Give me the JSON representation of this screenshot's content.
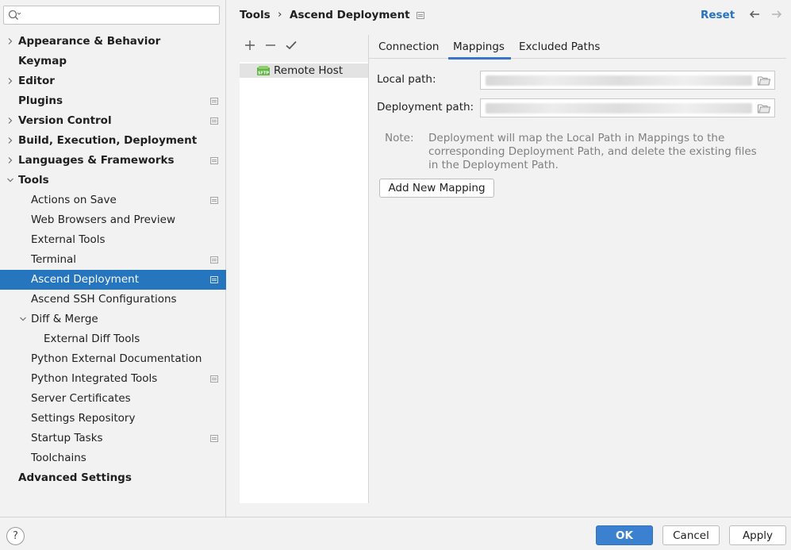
{
  "search": {
    "placeholder": ""
  },
  "sidebar": {
    "items": [
      {
        "label": "Appearance & Behavior",
        "level": 0,
        "bold": true,
        "expander": "collapsed",
        "badge": false,
        "selected": false
      },
      {
        "label": "Keymap",
        "level": 0,
        "bold": true,
        "expander": "none",
        "badge": false,
        "selected": false
      },
      {
        "label": "Editor",
        "level": 0,
        "bold": true,
        "expander": "collapsed",
        "badge": false,
        "selected": false
      },
      {
        "label": "Plugins",
        "level": 0,
        "bold": true,
        "expander": "none",
        "badge": true,
        "selected": false
      },
      {
        "label": "Version Control",
        "level": 0,
        "bold": true,
        "expander": "collapsed",
        "badge": true,
        "selected": false
      },
      {
        "label": "Build, Execution, Deployment",
        "level": 0,
        "bold": true,
        "expander": "collapsed",
        "badge": false,
        "selected": false
      },
      {
        "label": "Languages & Frameworks",
        "level": 0,
        "bold": true,
        "expander": "collapsed",
        "badge": true,
        "selected": false
      },
      {
        "label": "Tools",
        "level": 0,
        "bold": true,
        "expander": "expanded",
        "badge": false,
        "selected": false
      },
      {
        "label": "Actions on Save",
        "level": 1,
        "bold": false,
        "expander": "none",
        "badge": true,
        "selected": false
      },
      {
        "label": "Web Browsers and Preview",
        "level": 1,
        "bold": false,
        "expander": "none",
        "badge": false,
        "selected": false
      },
      {
        "label": "External Tools",
        "level": 1,
        "bold": false,
        "expander": "none",
        "badge": false,
        "selected": false
      },
      {
        "label": "Terminal",
        "level": 1,
        "bold": false,
        "expander": "none",
        "badge": true,
        "selected": false
      },
      {
        "label": "Ascend Deployment",
        "level": 1,
        "bold": false,
        "expander": "none",
        "badge": true,
        "selected": true
      },
      {
        "label": "Ascend SSH Configurations",
        "level": 1,
        "bold": false,
        "expander": "none",
        "badge": false,
        "selected": false
      },
      {
        "label": "Diff & Merge",
        "level": 1,
        "bold": false,
        "expander": "expanded",
        "badge": false,
        "selected": false
      },
      {
        "label": "External Diff Tools",
        "level": 2,
        "bold": false,
        "expander": "none",
        "badge": false,
        "selected": false
      },
      {
        "label": "Python External Documentation",
        "level": 1,
        "bold": false,
        "expander": "none",
        "badge": false,
        "selected": false
      },
      {
        "label": "Python Integrated Tools",
        "level": 1,
        "bold": false,
        "expander": "none",
        "badge": true,
        "selected": false
      },
      {
        "label": "Server Certificates",
        "level": 1,
        "bold": false,
        "expander": "none",
        "badge": false,
        "selected": false
      },
      {
        "label": "Settings Repository",
        "level": 1,
        "bold": false,
        "expander": "none",
        "badge": false,
        "selected": false
      },
      {
        "label": "Startup Tasks",
        "level": 1,
        "bold": false,
        "expander": "none",
        "badge": true,
        "selected": false
      },
      {
        "label": "Toolchains",
        "level": 1,
        "bold": false,
        "expander": "none",
        "badge": false,
        "selected": false
      },
      {
        "label": "Advanced Settings",
        "level": 0,
        "bold": true,
        "expander": "none",
        "badge": false,
        "selected": false
      }
    ]
  },
  "header": {
    "breadcrumb_parent": "Tools",
    "breadcrumb_separator": "›",
    "breadcrumb_current": "Ascend Deployment",
    "reset_label": "Reset"
  },
  "servers": {
    "toolbar": {
      "add_icon": "plus-icon",
      "remove_icon": "minus-icon",
      "default_icon": "check-icon"
    },
    "items": [
      {
        "label": "Remote Host",
        "icon": "sftp-icon",
        "selected": true
      }
    ]
  },
  "tabs": [
    {
      "label": "Connection",
      "active": false
    },
    {
      "label": "Mappings",
      "active": true
    },
    {
      "label": "Excluded Paths",
      "active": false
    }
  ],
  "mapping": {
    "local_label": "Local path:",
    "local_value": "",
    "deployment_label": "Deployment path:",
    "deployment_value": "",
    "note_label": "Note:",
    "note_text": "Deployment will map the Local Path in Mappings to the corresponding Deployment Path, and delete the existing files in the Deployment Path.",
    "add_button": "Add New Mapping"
  },
  "footer": {
    "help": "?",
    "ok": "OK",
    "cancel": "Cancel",
    "apply": "Apply"
  },
  "colors": {
    "selection": "#2675bf",
    "link": "#2573c2",
    "primary_button": "#3b81cf",
    "tab_underline": "#3874c8"
  }
}
